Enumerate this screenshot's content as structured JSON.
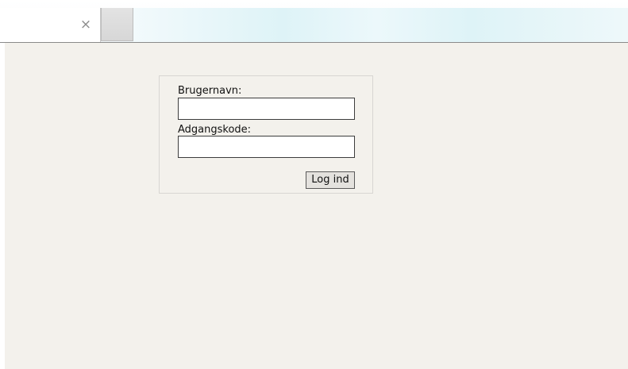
{
  "browser": {
    "tab_close_glyph": "×"
  },
  "login_form": {
    "username_label": "Brugernavn:",
    "username_value": "",
    "password_label": "Adgangskode:",
    "password_value": "",
    "submit_label": "Log ind"
  }
}
